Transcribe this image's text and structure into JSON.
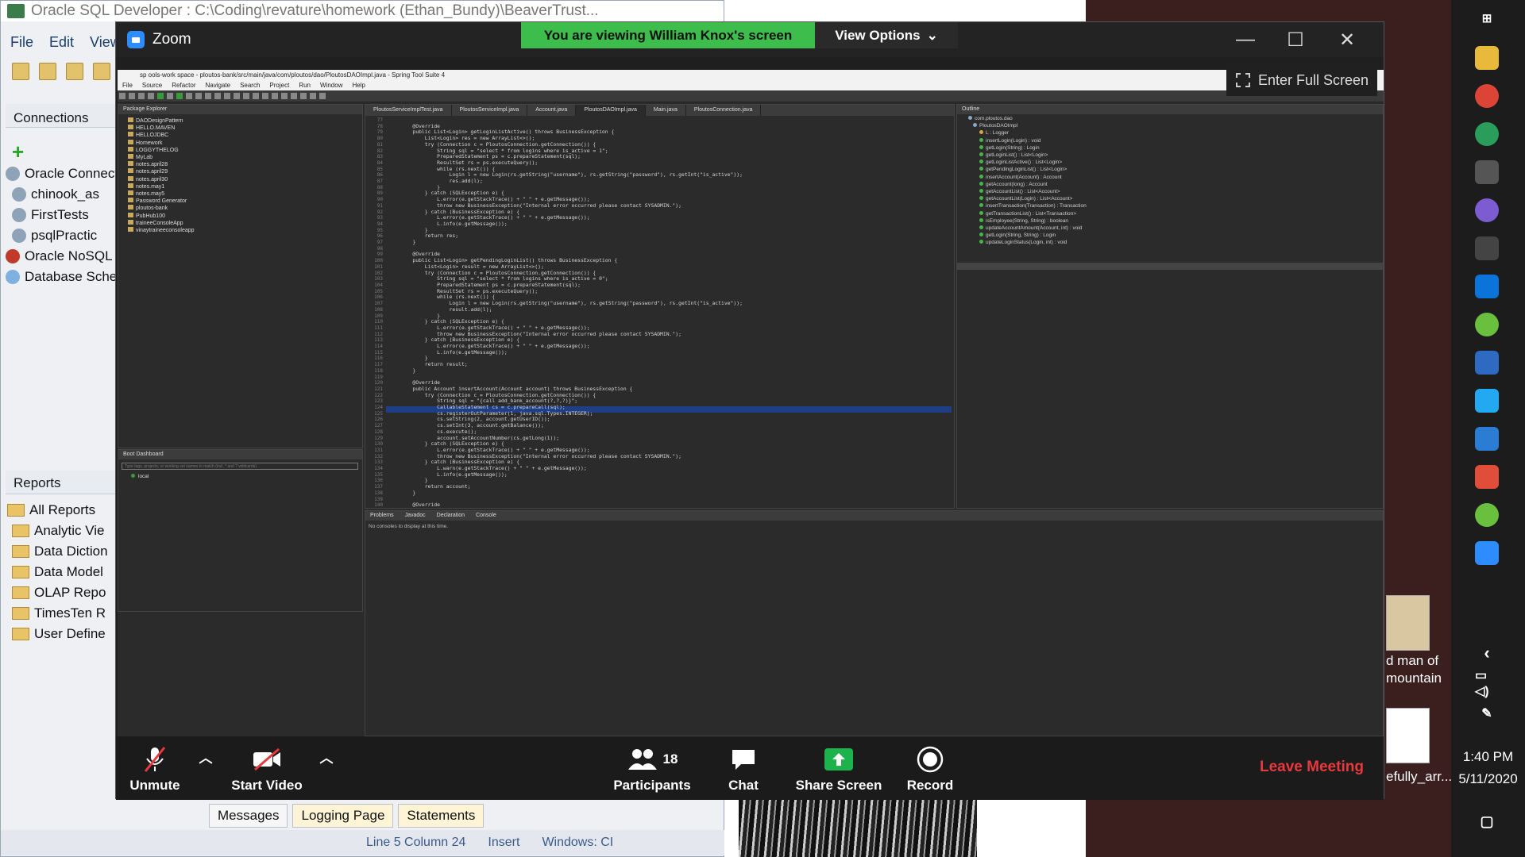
{
  "sqldev": {
    "title": "Oracle SQL Developer : C:\\Coding\\revature\\homework (Ethan_Bundy)\\BeaverTrust...",
    "menu": [
      "File",
      "Edit",
      "View"
    ],
    "connections_title": "Connections",
    "connections": [
      "Oracle Connect",
      "chinook_as",
      "FirstTests",
      "psqlPractic",
      "Oracle NoSQL C",
      "Database Scher"
    ],
    "reports_title": "Reports",
    "reports": [
      "All Reports",
      "Analytic Vie",
      "Data Diction",
      "Data Model",
      "OLAP Repo",
      "TimesTen R",
      "User Define"
    ],
    "bottom_tabs": [
      "Messages",
      "Logging Page",
      "Statements"
    ],
    "status": {
      "position": "Line 5 Column 24",
      "mode": "Insert",
      "platform": "Windows: CI"
    }
  },
  "zoom": {
    "title": "Zoom",
    "viewing_banner": "You are viewing William Knox's screen",
    "view_options": "View Options",
    "enter_full_screen": "Enter Full Screen",
    "controls": {
      "unmute": "Unmute",
      "start_video": "Start Video",
      "participants": "Participants",
      "participants_count": "18",
      "chat": "Chat",
      "share_screen": "Share Screen",
      "record": "Record",
      "leave": "Leave Meeting"
    }
  },
  "sts": {
    "title": "sp   ools-work space - ploutos-bank/src/main/java/com/ploutos/dao/PloutosDAOImpl.java - Spring Tool Suite 4",
    "menu": [
      "File",
      "Source",
      "Refactor",
      "Navigate",
      "Search",
      "Project",
      "Run",
      "Window",
      "Help"
    ],
    "package_explorer": "Package Explorer",
    "projects": [
      "DAODesignPattern",
      "HELLO.MAVEN",
      "HELLOJDBC",
      "Homework",
      "LOGGYTHELOG",
      "MyLab",
      "notes.april28",
      "notes.april29",
      "notes.april30",
      "notes.may1",
      "notes.may5",
      "Password Generator",
      "ploutos-bank",
      "PubHub100",
      "traineeConsoleApp",
      "vinaytraineeconsoleapp"
    ],
    "boot_dashboard": "Boot Dashboard",
    "boot_filter": "Type tags, projects, or working set names to match (incl. * and ? wildcards)",
    "boot_local": "local",
    "editor_tabs": [
      "PloutosServiceImplTest.java",
      "PloutosServiceImpl.java",
      "Account.java",
      "PloutosDAOImpl.java",
      "Main.java",
      "PloutosConnection.java"
    ],
    "active_tab": "PloutosDAOImpl.java",
    "line_numbers": [
      "77",
      "78",
      "79",
      "80",
      "81",
      "82",
      "83",
      "84",
      "85",
      "86",
      "87",
      "88",
      "89",
      "90",
      "91",
      "92",
      "93",
      "94",
      "95",
      "96",
      "97",
      "98",
      "99",
      "100",
      "101",
      "102",
      "103",
      "104",
      "105",
      "106",
      "107",
      "108",
      "109",
      "110",
      "111",
      "112",
      "113",
      "114",
      "115",
      "116",
      "117",
      "118",
      "119",
      "120",
      "121",
      "122",
      "123",
      "124",
      "125",
      "126",
      "127",
      "128",
      "129",
      "130",
      "131",
      "132",
      "133",
      "134",
      "135",
      "136",
      "137",
      "138",
      "139",
      "140"
    ],
    "code": [
      "",
      "    @Override",
      "    public List<Login> getLoginListActive() throws BusinessException {",
      "        List<Login> res = new ArrayList<>();",
      "        try (Connection c = PloutosConnection.getConnection()) {",
      "            String sql = \"select * from logins where is_active = 1\";",
      "            PreparedStatement ps = c.prepareStatement(sql);",
      "            ResultSet rs = ps.executeQuery();",
      "            while (rs.next()) {",
      "                Login l = new Login(rs.getString(\"username\"), rs.getString(\"password\"), rs.getInt(\"is_active\"));",
      "                res.add(l);",
      "            }",
      "        } catch (SQLException e) {",
      "            L.error(e.getStackTrace() + \" \" + e.getMessage());",
      "            throw new BusinessException(\"Internal error occurred please contact SYSADMIN.\");",
      "        } catch (BusinessException e) {",
      "            L.error(e.getStackTrace() + \" \" + e.getMessage());",
      "            L.info(e.getMessage());",
      "        }",
      "        return res;",
      "    }",
      "",
      "    @Override",
      "    public List<Login> getPendingLoginList() throws BusinessException {",
      "        List<Login> result = new ArrayList<>();",
      "        try (Connection c = PloutosConnection.getConnection()) {",
      "            String sql = \"select * from logins where is_active = 0\";",
      "            PreparedStatement ps = c.prepareStatement(sql);",
      "            ResultSet rs = ps.executeQuery();",
      "            while (rs.next()) {",
      "                Login l = new Login(rs.getString(\"username\"), rs.getString(\"password\"), rs.getInt(\"is_active\"));",
      "                result.add(l);",
      "            }",
      "        } catch (SQLException e) {",
      "            L.error(e.getStackTrace() + \" \" + e.getMessage());",
      "            throw new BusinessException(\"Internal error occurred please contact SYSADMIN.\");",
      "        } catch (BusinessException e) {",
      "            L.error(e.getStackTrace() + \" \" + e.getMessage());",
      "            L.info(e.getMessage());",
      "        }",
      "        return result;",
      "    }",
      "",
      "    @Override",
      "    public Account insertAccount(Account account) throws BusinessException {",
      "        try (Connection c = PloutosConnection.getConnection()) {",
      "            String sql = \"{call add_bank_account(?,?,?)}\";",
      "            CallableStatement cs = c.prepareCall(sql);",
      "            cs.registerOutParameter(1, java.sql.Types.INTEGER);",
      "            cs.setString(2, account.getUserID());",
      "            cs.setInt(3, account.getBalance());",
      "            cs.execute();",
      "            account.setAccountNumber(cs.getLong(1));",
      "        } catch (SQLException e) {",
      "            L.error(e.getStackTrace() + \" \" + e.getMessage());",
      "            throw new BusinessException(\"Internal error occurred please contact SYSADMIN.\");",
      "        } catch (BusinessException e) {",
      "            L.warn(e.getStackTrace() + \" \" + e.getMessage());",
      "            L.info(e.getMessage());",
      "        }",
      "        return account;",
      "    }",
      "",
      "    @Override"
    ],
    "outline_title": "Outline",
    "outline": [
      "com.ploutos.dao",
      "PloutosDAOImpl",
      "L : Logger",
      "insertLogin(Login) : void",
      "getLogin(String) : Login",
      "getLoginList() : List<Login>",
      "getLoginListActive() : List<Login>",
      "getPendingLoginList() : List<Login>",
      "insertAccount(Account) : Account",
      "getAccount(long) : Account",
      "getAccountList() : List<Account>",
      "getAccountList(Login) : List<Account>",
      "insertTransaction(Transaction) : Transaction",
      "getTransactionList() : List<Transaction>",
      "isEmployee(String, String) : boolean",
      "updateAccountAmount(Account, int) : void",
      "getLogin(String, String) : Login",
      "updateLoginStatus(Login, int) : void"
    ],
    "console_tabs": [
      "Problems",
      "Javadoc",
      "Declaration",
      "Console"
    ],
    "console_msg": "No consoles to display at this time."
  },
  "desktop": {
    "item1": "d man of mountain",
    "item2": "efully_arr..."
  },
  "taskbar": {
    "time": "1:40 PM",
    "date": "5/11/2020"
  }
}
